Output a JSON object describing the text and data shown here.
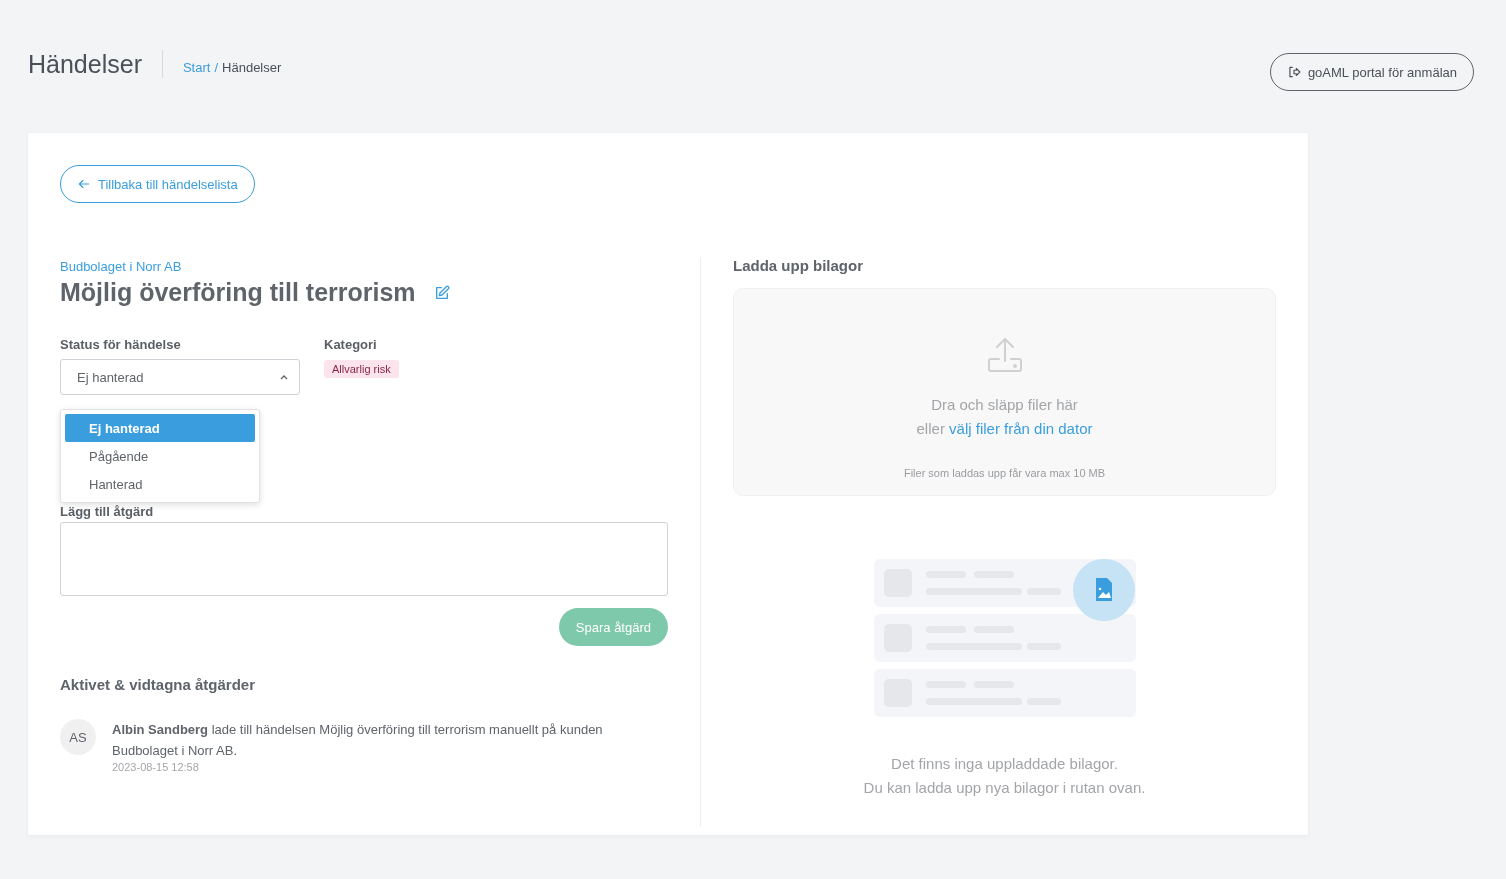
{
  "page_title": "Händelser",
  "breadcrumb": {
    "separator": "/",
    "items": [
      {
        "label": "Start",
        "link": true
      },
      {
        "label": "Händelser",
        "link": false
      }
    ]
  },
  "portal_button": "goAML portal för anmälan",
  "back_button": "Tillbaka till händelselista",
  "customer": "Budbolaget i Norr AB",
  "event_title": "Möjlig överföring till terrorism",
  "status": {
    "label": "Status för händelse",
    "value": "Ej hanterad",
    "expanded": true,
    "options": [
      {
        "label": "Ej hanterad",
        "selected": true
      },
      {
        "label": "Pågående",
        "selected": false
      },
      {
        "label": "Hanterad",
        "selected": false
      }
    ]
  },
  "category": {
    "label": "Kategori",
    "tag": "Allvarlig risk",
    "color": "#fce4ec"
  },
  "action": {
    "label": "Lägg till åtgärd",
    "save_button": "Spara åtgärd",
    "disabled": true
  },
  "activity": {
    "title": "Aktivet & vidtagna åtgärder",
    "items": [
      {
        "initials": "AS",
        "text": "**Albin Sandberg** lade till händelsen Möjlig överföring till terrorism manuellt på kunden Budbolaget i Norr AB.",
        "time": "2023-08-15 12:58"
      }
    ]
  },
  "upload": {
    "title": "Ladda upp bilagor",
    "drop_text": "Dra och släpp filer här",
    "choose_prefix": "eller",
    "choose_link": "välj filer från din dator",
    "limit": "Filer som laddas upp får vara max 10 MB"
  },
  "empty": {
    "line1": "Det finns inga uppladdade bilagor.",
    "line2": "Du kan ladda upp nya bilagor i rutan ovan."
  }
}
